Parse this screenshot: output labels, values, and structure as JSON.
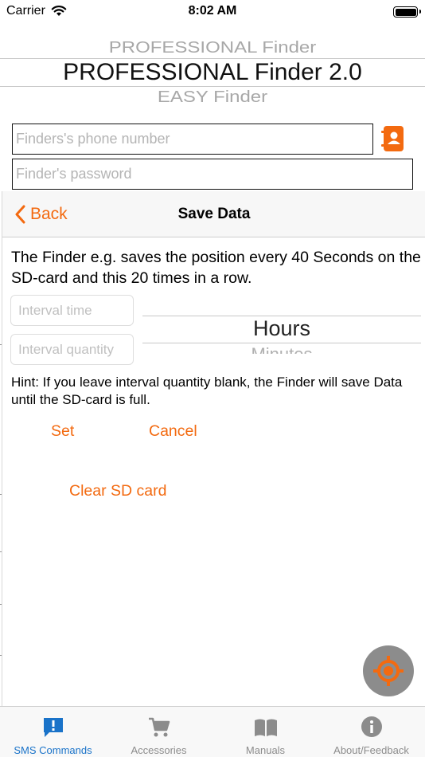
{
  "status_bar": {
    "carrier": "Carrier",
    "time": "8:02 AM",
    "wifi_icon": "wifi-icon",
    "battery_icon": "battery-icon"
  },
  "device_picker": {
    "above": "PROFESSIONAL Finder",
    "selected": "PROFESSIONAL Finder 2.0",
    "below": "EASY Finder"
  },
  "form": {
    "phone_placeholder": "Finders's phone number",
    "password_placeholder": "Finder's password",
    "contact_icon": "contact-book-icon"
  },
  "sheet": {
    "back_label": "Back",
    "title": "Save Data",
    "description": "The Finder e.g. saves the position every 40 Seconds on the SD-card and this 20 times in a row.",
    "interval_time_placeholder": "Interval time",
    "interval_quantity_placeholder": "Interval quantity",
    "unit_picker": {
      "selected": "Hours",
      "next": "Minutes"
    },
    "hint": "Hint: If you leave interval quantity blank, the Finder will save Data until the SD-card is full.",
    "set_label": "Set",
    "cancel_label": "Cancel",
    "clear_label": "Clear SD card"
  },
  "locate_icon": "locate-target-icon",
  "tabbar": {
    "tabs": [
      {
        "label": "SMS Commands",
        "icon": "message-alert-icon",
        "active": true
      },
      {
        "label": "Accessories",
        "icon": "cart-icon",
        "active": false
      },
      {
        "label": "Manuals",
        "icon": "book-icon",
        "active": false
      },
      {
        "label": "About/Feedback",
        "icon": "info-icon",
        "active": false
      }
    ]
  },
  "colors": {
    "accent": "#f36a10",
    "tab_active": "#1a73c9",
    "tab_inactive": "#8c8c8c"
  }
}
